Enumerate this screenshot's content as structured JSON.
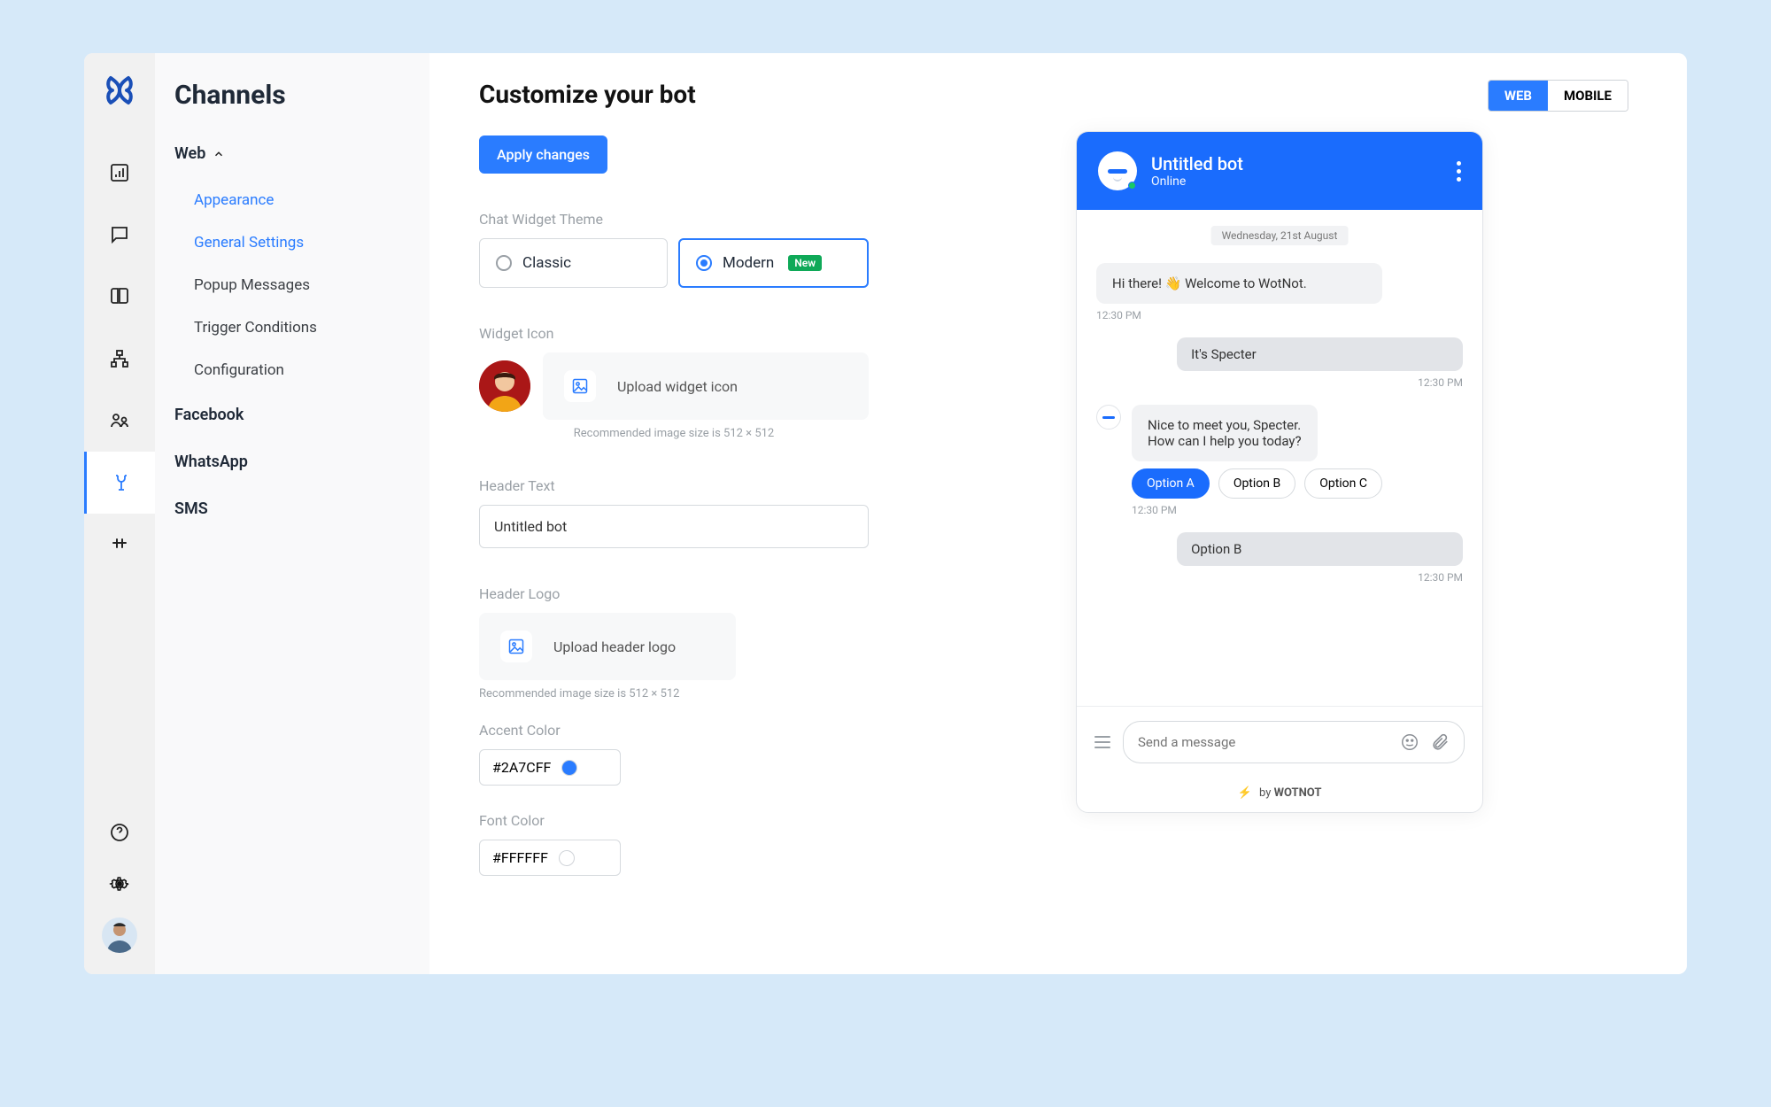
{
  "sidebar": {
    "title": "Channels",
    "web_label": "Web",
    "items": [
      "Appearance",
      "General Settings",
      "Popup Messages",
      "Trigger Conditions",
      "Configuration"
    ],
    "channels": [
      "Facebook",
      "WhatsApp",
      "SMS"
    ]
  },
  "config": {
    "title": "Customize your bot",
    "apply": "Apply changes",
    "theme_label": "Chat Widget Theme",
    "theme_classic": "Classic",
    "theme_modern": "Modern",
    "theme_badge": "New",
    "widget_icon_label": "Widget Icon",
    "upload_widget": "Upload widget icon",
    "widget_hint": "Recommended image size is 512 × 512",
    "header_text_label": "Header Text",
    "header_text_value": "Untitled bot",
    "header_logo_label": "Header Logo",
    "upload_logo": "Upload header logo",
    "logo_hint": "Recommended image size is 512 × 512",
    "accent_label": "Accent Color",
    "accent_value": "#2A7CFF",
    "font_label": "Font Color",
    "font_value": "#FFFFFF"
  },
  "preview": {
    "tab_web": "WEB",
    "tab_mobile": "MOBILE",
    "bot_title": "Untitled bot",
    "bot_status": "Online",
    "date": "Wednesday, 21st August",
    "msg1": "Hi there! 👋  Welcome to WotNot.",
    "ts": "12:30 PM",
    "msg2": "It's Specter",
    "msg3a": "Nice to meet you, Specter.",
    "msg3b": "How can I help you today?",
    "options": [
      "Option A",
      "Option B",
      "Option C"
    ],
    "msg4": "Option  B",
    "input_placeholder": "Send a message",
    "footer_by": "by",
    "footer_brand": "WOTNOT"
  }
}
